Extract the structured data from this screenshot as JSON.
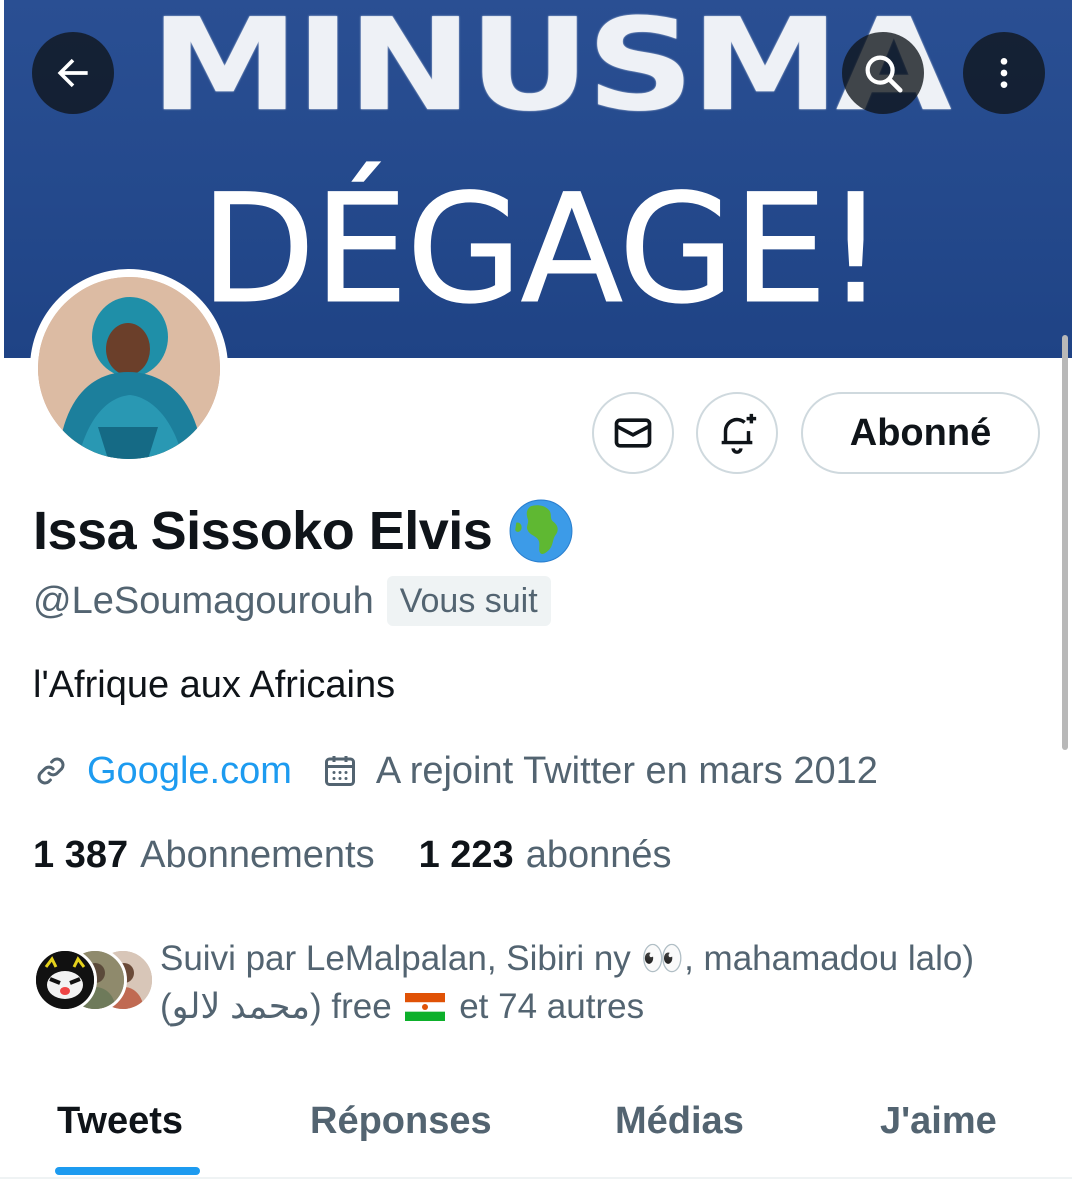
{
  "banner": {
    "line1": "MINUSMA",
    "line2": "DÉGAGE!",
    "bg_color": "#24498c"
  },
  "header_actions": {
    "back_icon": "arrow-left-icon",
    "search_icon": "search-icon",
    "more_icon": "more-vertical-icon"
  },
  "profile": {
    "display_name": "Issa Sissoko Elvis",
    "name_emoji": "globe-africa-icon",
    "handle": "@LeSoumagourouh",
    "follows_you": "Vous suit",
    "bio": "l'Afrique aux Africains",
    "link_text": "Google.com",
    "joined": "A rejoint Twitter en mars 2012"
  },
  "actions": {
    "message_icon": "envelope-icon",
    "notify_icon": "bell-plus-icon",
    "follow_label": "Abonné"
  },
  "stats": {
    "following_count": "1 387",
    "following_label": "Abonnements",
    "followers_count": "1 223",
    "followers_label": "abonnés"
  },
  "followed_by": {
    "text_part1": "Suivi par LeMalpalan, Sibiri ny 👀, mahamadou lalo) (محمد لالو) free",
    "flag": "niger-flag-icon",
    "text_part2": "et 74 autres"
  },
  "tabs": [
    {
      "label": "Tweets",
      "active": true
    },
    {
      "label": "Réponses",
      "active": false
    },
    {
      "label": "Médias",
      "active": false
    },
    {
      "label": "J'aime",
      "active": false
    }
  ],
  "colors": {
    "accent": "#1d9bf0",
    "secondary_text": "#536471",
    "primary_text": "#0f1419"
  }
}
